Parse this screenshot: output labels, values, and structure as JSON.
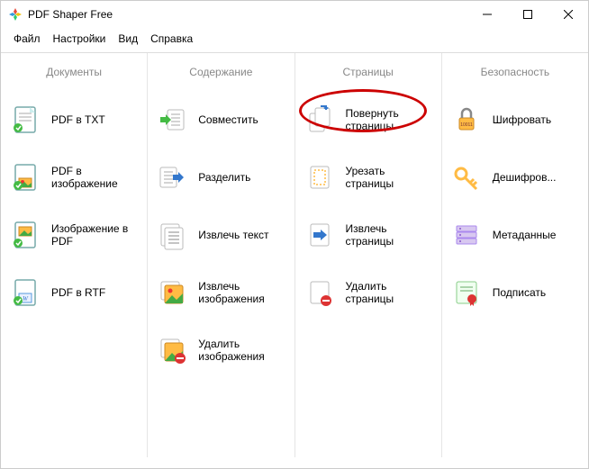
{
  "window": {
    "title": "PDF Shaper Free"
  },
  "menu": {
    "file": "Файл",
    "settings": "Настройки",
    "view": "Вид",
    "help": "Справка"
  },
  "columns": {
    "documents": {
      "header": "Документы",
      "items": [
        {
          "label": "PDF в TXT"
        },
        {
          "label": "PDF в изображение"
        },
        {
          "label": "Изображение в PDF"
        },
        {
          "label": "PDF в RTF"
        }
      ]
    },
    "content": {
      "header": "Содержание",
      "items": [
        {
          "label": "Совместить"
        },
        {
          "label": "Разделить"
        },
        {
          "label": "Извлечь текст"
        },
        {
          "label": "Извлечь изображения"
        },
        {
          "label": "Удалить изображения"
        }
      ]
    },
    "pages": {
      "header": "Страницы",
      "items": [
        {
          "label": "Повернуть страницы"
        },
        {
          "label": "Урезать страницы"
        },
        {
          "label": "Извлечь страницы"
        },
        {
          "label": "Удалить страницы"
        }
      ]
    },
    "security": {
      "header": "Безопасность",
      "items": [
        {
          "label": "Шифровать"
        },
        {
          "label": "Дешифров..."
        },
        {
          "label": "Метаданные"
        },
        {
          "label": "Подписать"
        }
      ]
    }
  }
}
